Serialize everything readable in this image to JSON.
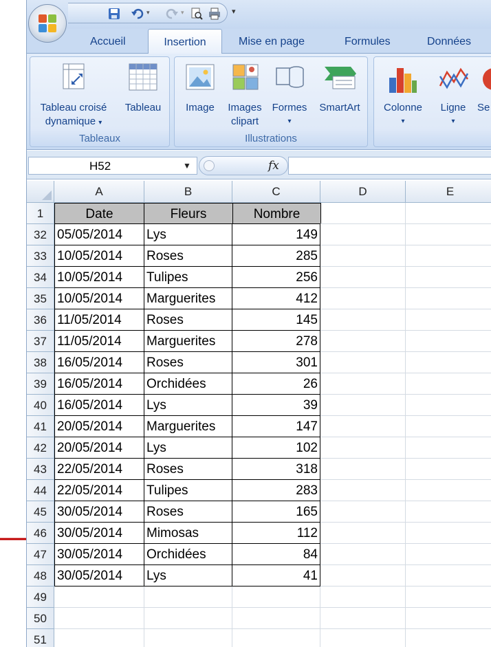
{
  "quick_access": {
    "icons": [
      "office-button-icon",
      "save-icon",
      "undo-icon",
      "redo-icon",
      "print-preview-icon",
      "print-icon",
      "customize-dropdown-icon"
    ]
  },
  "tabs": [
    {
      "label": "Accueil"
    },
    {
      "label": "Insertion",
      "active": true
    },
    {
      "label": "Mise en page"
    },
    {
      "label": "Formules"
    },
    {
      "label": "Données"
    }
  ],
  "ribbon": {
    "groups": {
      "tableaux": {
        "label": "Tableaux",
        "pivot_line1": "Tableau croisé",
        "pivot_line2": "dynamique",
        "table": "Tableau"
      },
      "illustrations": {
        "label": "Illustrations",
        "image": "Image",
        "clipart_line1": "Images",
        "clipart_line2": "clipart",
        "shapes": "Formes",
        "smartart": "SmartArt"
      },
      "charts": {
        "column": "Colonne",
        "line": "Ligne",
        "pie_partial": "Se"
      }
    }
  },
  "formula_bar": {
    "name_box": "H52",
    "fx": "fx",
    "formula": ""
  },
  "columns": [
    "A",
    "B",
    "C",
    "D",
    "E"
  ],
  "header_row": {
    "row": "1",
    "date": "Date",
    "fleurs": "Fleurs",
    "nombre": "Nombre"
  },
  "rows": [
    {
      "row": "32",
      "date": "05/05/2014",
      "fleur": "Lys",
      "nombre": "149"
    },
    {
      "row": "33",
      "date": "10/05/2014",
      "fleur": "Roses",
      "nombre": "285"
    },
    {
      "row": "34",
      "date": "10/05/2014",
      "fleur": "Tulipes",
      "nombre": "256"
    },
    {
      "row": "35",
      "date": "10/05/2014",
      "fleur": "Marguerites",
      "nombre": "412"
    },
    {
      "row": "36",
      "date": "11/05/2014",
      "fleur": "Roses",
      "nombre": "145"
    },
    {
      "row": "37",
      "date": "11/05/2014",
      "fleur": "Marguerites",
      "nombre": "278"
    },
    {
      "row": "38",
      "date": "16/05/2014",
      "fleur": "Roses",
      "nombre": "301"
    },
    {
      "row": "39",
      "date": "16/05/2014",
      "fleur": "Orchidées",
      "nombre": "26"
    },
    {
      "row": "40",
      "date": "16/05/2014",
      "fleur": "Lys",
      "nombre": "39"
    },
    {
      "row": "41",
      "date": "20/05/2014",
      "fleur": "Marguerites",
      "nombre": "147"
    },
    {
      "row": "42",
      "date": "20/05/2014",
      "fleur": "Lys",
      "nombre": "102"
    },
    {
      "row": "43",
      "date": "22/05/2014",
      "fleur": "Roses",
      "nombre": "318"
    },
    {
      "row": "44",
      "date": "22/05/2014",
      "fleur": "Tulipes",
      "nombre": "283"
    },
    {
      "row": "45",
      "date": "30/05/2014",
      "fleur": "Roses",
      "nombre": "165"
    },
    {
      "row": "46",
      "date": "30/05/2014",
      "fleur": "Mimosas",
      "nombre": "112"
    },
    {
      "row": "47",
      "date": "30/05/2014",
      "fleur": "Orchidées",
      "nombre": "84"
    },
    {
      "row": "48",
      "date": "30/05/2014",
      "fleur": "Lys",
      "nombre": "41"
    }
  ],
  "empty_rows": [
    "49",
    "50",
    "51"
  ],
  "annotation": {
    "icon": "red-arrow-icon",
    "points_to_row": "46",
    "color": "#c00000"
  }
}
